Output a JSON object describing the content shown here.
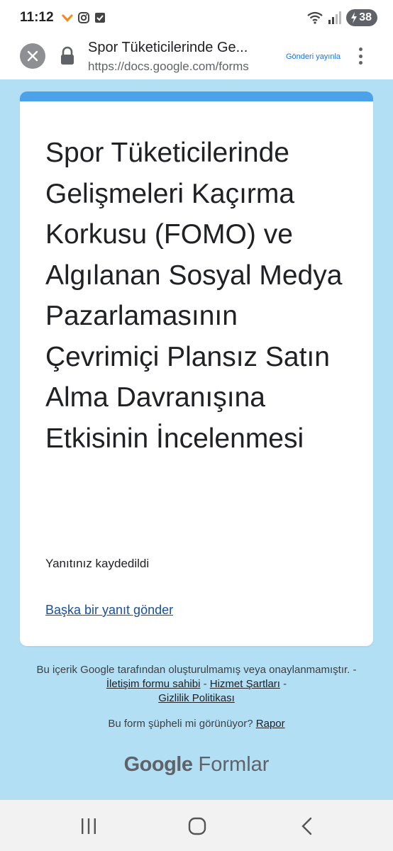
{
  "status_bar": {
    "time": "11:12",
    "battery": "38",
    "icons": [
      "heart-app-icon",
      "instagram-icon",
      "checkbox-app-icon",
      "wifi-icon",
      "signal-icon",
      "battery-charging-icon"
    ]
  },
  "browser": {
    "page_title": "Spor Tüketicilerinde Ge...",
    "url": "https://docs.google.com/forms",
    "publish_label": "Gönderi yayınla",
    "icons": [
      "close-icon",
      "lock-icon",
      "more-vert-icon"
    ]
  },
  "form": {
    "title": "Spor Tüketicilerinde Gelişmeleri Kaçırma Korkusu (FOMO) ve Algılanan Sosyal Medya Pazarlamasının Çevrimiçi Plansız Satın Alma Davranışına Etkisinin İncelenmesi",
    "confirmation": "Yanıtınız kaydedildi",
    "another_response_link": "Başka bir yanıt gönder"
  },
  "footer": {
    "disclaimer_text": "Bu içerik Google tarafından oluşturulmamış veya onaylanmamıştır.",
    "sep1": " - ",
    "contact_link": "İletişim formu sahibi",
    "sep2": " - ",
    "terms_link": "Hizmet Şartları",
    "sep3": " - ",
    "privacy_link": "Gizlilik Politikası",
    "report_question": "Bu form şüpheli mi görünüyor?",
    "report_link": "Rapor",
    "brand_google": "Google",
    "brand_product": "Formlar"
  },
  "nav": {
    "icons": [
      "recent-apps-icon",
      "home-icon",
      "back-icon"
    ]
  },
  "colors": {
    "background": "#b3dff5",
    "card_accent": "#4aa3e8",
    "link": "#1a4fa0",
    "publish": "#1a73e8"
  }
}
